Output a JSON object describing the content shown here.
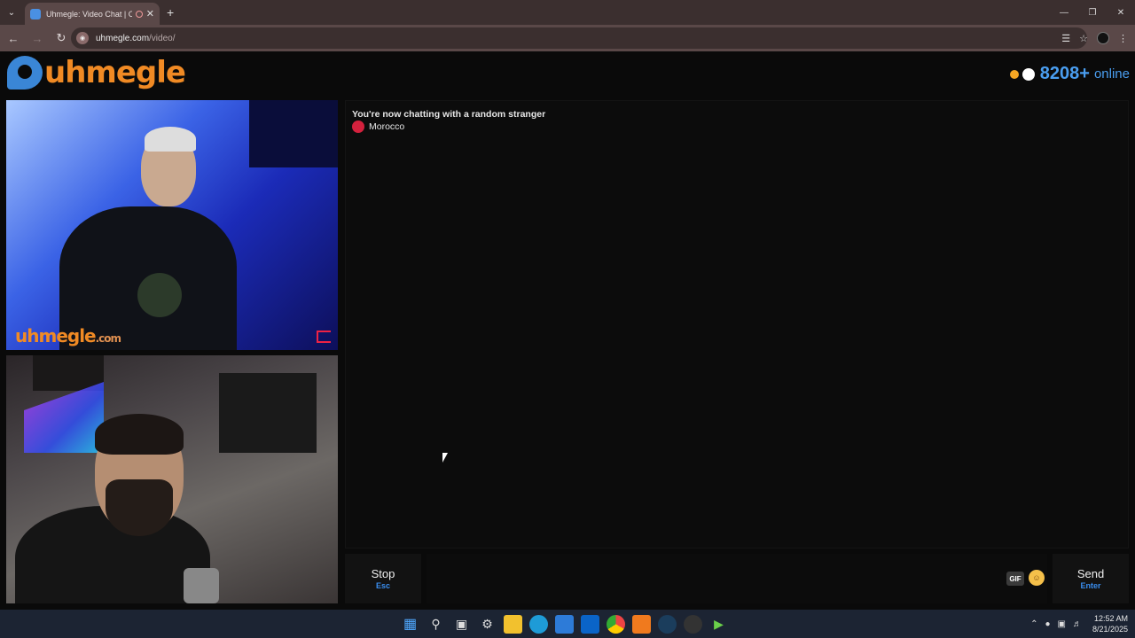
{
  "browser": {
    "tab_title": "Uhmegle: Video Chat | Om",
    "url_host": "uhmegle.com",
    "url_path": "/video/"
  },
  "site": {
    "logo_text": "uhmegle",
    "online_count": "8208+",
    "online_label": "online"
  },
  "stranger_video": {
    "watermark": "uhmegle",
    "watermark_suffix": ".com"
  },
  "chat": {
    "status_text": "You're now chatting with a random stranger",
    "country": "Morocco"
  },
  "controls": {
    "stop_label": "Stop",
    "stop_shortcut": "Esc",
    "gif_label": "GIF",
    "send_label": "Send",
    "send_shortcut": "Enter",
    "message_placeholder": ""
  },
  "taskbar": {
    "time": "12:52 AM",
    "date": "8/21/2025"
  },
  "colors": {
    "brand_orange": "#f08a24",
    "accent_blue": "#4a9ef0",
    "country_flag_red": "#d4213d"
  }
}
